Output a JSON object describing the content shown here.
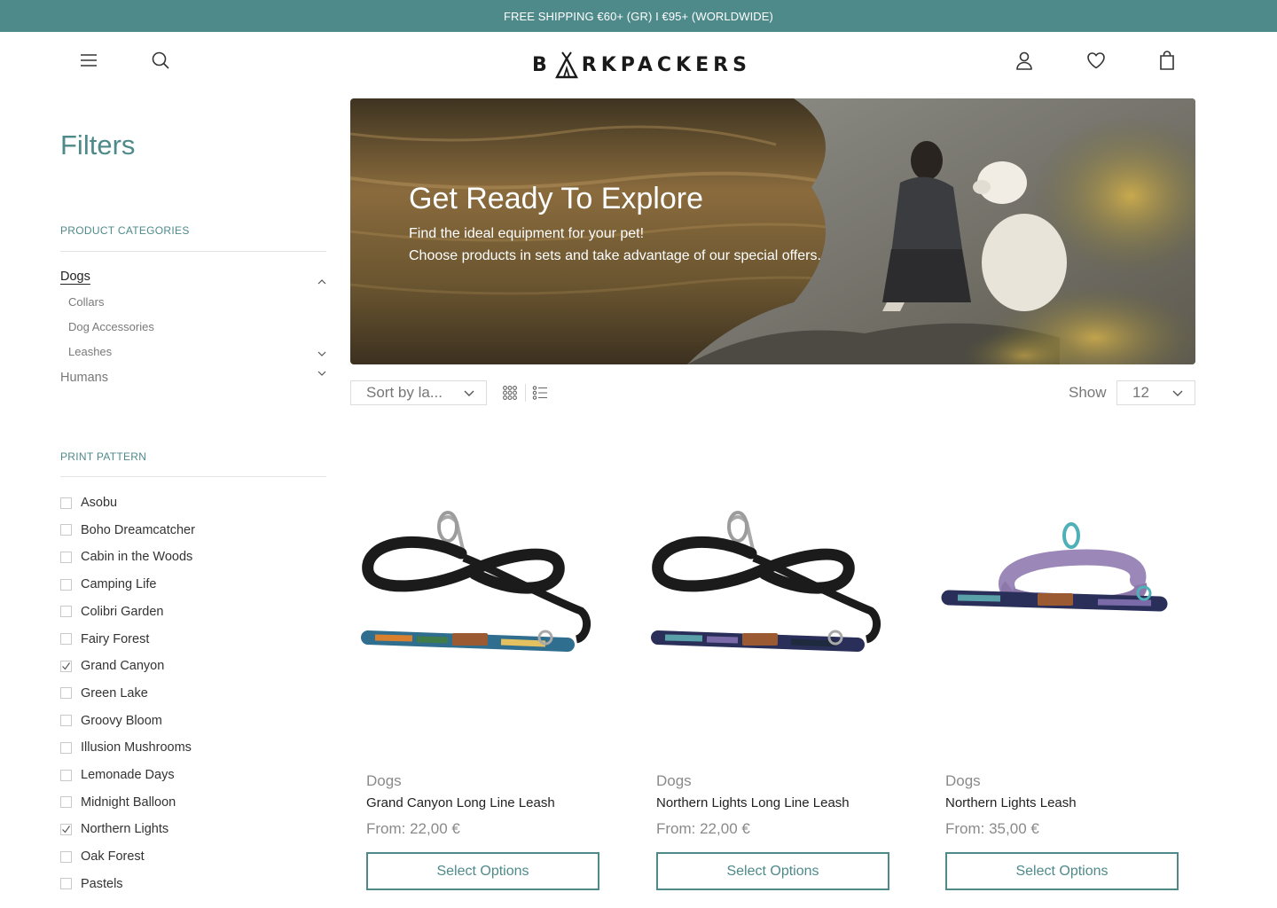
{
  "announcement": "FREE SHIPPING €60+ (GR) I €95+ (WORLDWIDE)",
  "brand": {
    "logo_left": "B",
    "logo_right": "RKPACKERS",
    "icons": {
      "menu": "hamburger-icon",
      "search": "search-icon",
      "account": "user-icon",
      "wishlist": "heart-icon",
      "cart": "bag-icon"
    }
  },
  "filters": {
    "title": "Filters",
    "categories": {
      "label": "PRODUCT CATEGORIES",
      "items": [
        {
          "label": "Dogs",
          "expanded": true,
          "children": [
            "Collars",
            "Dog Accessories",
            "Leashes"
          ]
        },
        {
          "label": "Humans",
          "expanded": false,
          "children": []
        }
      ]
    },
    "print_pattern": {
      "label": "PRINT PATTERN",
      "items": [
        {
          "label": "Asobu",
          "checked": false
        },
        {
          "label": "Boho Dreamcatcher",
          "checked": false
        },
        {
          "label": "Cabin in the Woods",
          "checked": false
        },
        {
          "label": "Camping Life",
          "checked": false
        },
        {
          "label": "Colibri Garden",
          "checked": false
        },
        {
          "label": "Fairy Forest",
          "checked": false
        },
        {
          "label": "Grand Canyon",
          "checked": true
        },
        {
          "label": "Green Lake",
          "checked": false
        },
        {
          "label": "Groovy Bloom",
          "checked": false
        },
        {
          "label": "Illusion Mushrooms",
          "checked": false
        },
        {
          "label": "Lemonade Days",
          "checked": false
        },
        {
          "label": "Midnight Balloon",
          "checked": false
        },
        {
          "label": "Northern Lights",
          "checked": true
        },
        {
          "label": "Oak Forest",
          "checked": false
        },
        {
          "label": "Pastels",
          "checked": false
        }
      ]
    }
  },
  "hero": {
    "title": "Get Ready To Explore",
    "line1": "Find the ideal equipment for your pet!",
    "line2": "Choose products in sets and take advantage of our special offers."
  },
  "toolbar": {
    "sort_value": "Sort by la...",
    "show_label": "Show",
    "show_value": "12"
  },
  "products": [
    {
      "category": "Dogs",
      "name": "Grand Canyon Long Line Leash",
      "price": "From: 22,00 €",
      "button": "Select Options",
      "strap_color": "#1b1b1b",
      "pattern": "grand-canyon"
    },
    {
      "category": "Dogs",
      "name": "Northern Lights Long Line Leash",
      "price": "From: 22,00 €",
      "button": "Select Options",
      "strap_color": "#1b1b1b",
      "pattern": "northern-lights"
    },
    {
      "category": "Dogs",
      "name": "Northern Lights Leash",
      "price": "From: 35,00 €",
      "button": "Select Options",
      "strap_color": "#9b87b8",
      "pattern": "northern-lights"
    }
  ],
  "colors": {
    "accent": "#4f8a8b"
  }
}
